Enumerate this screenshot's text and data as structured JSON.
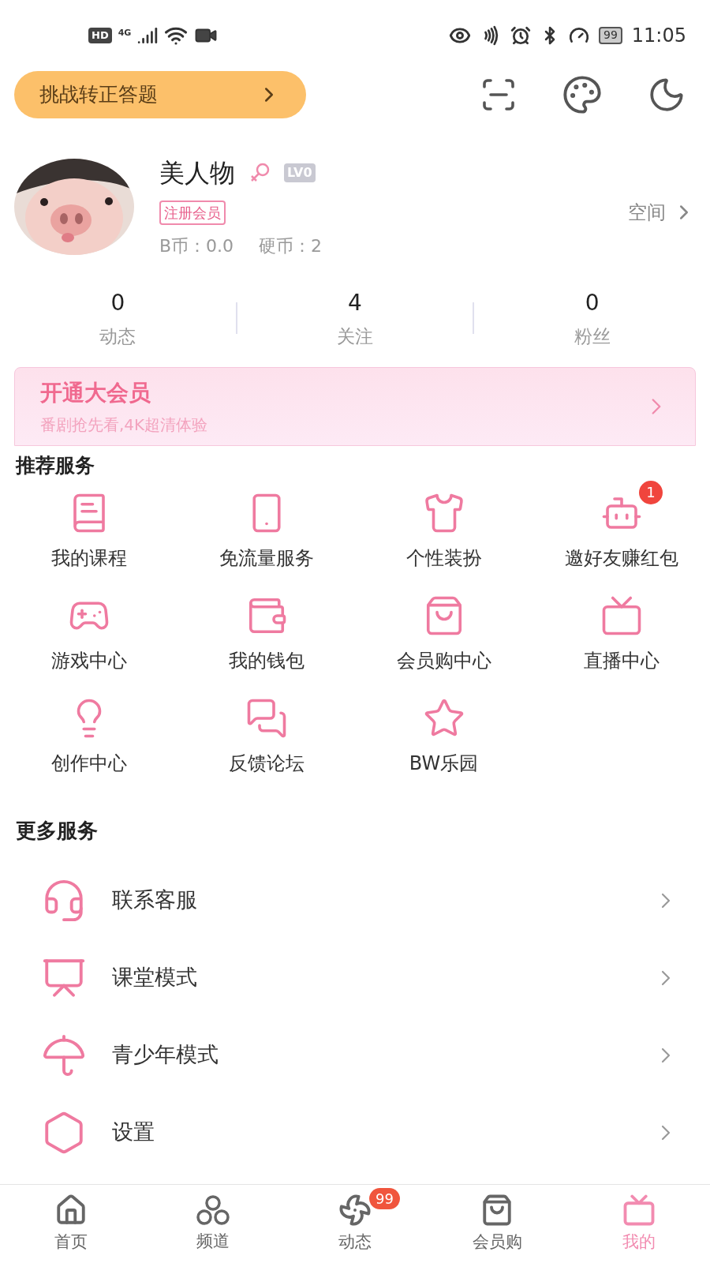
{
  "status_bar": {
    "hd": "HD",
    "network": "4G",
    "battery": "99",
    "time": "11:05"
  },
  "top_bar": {
    "quiz_button": "挑战转正答题"
  },
  "profile": {
    "name": "美人物",
    "level": "LV0",
    "member_tag": "注册会员",
    "b_coins": "B币：0.0",
    "coins": "硬币：2",
    "space_link": "空间"
  },
  "stats": [
    {
      "value": "0",
      "label": "动态"
    },
    {
      "value": "4",
      "label": "关注"
    },
    {
      "value": "0",
      "label": "粉丝"
    }
  ],
  "vip_banner": {
    "title": "开通大会员",
    "subtitle": "番剧抢先看,4K超清体验"
  },
  "recommended": {
    "title": "推荐服务",
    "items": [
      {
        "label": "我的课程"
      },
      {
        "label": "免流量服务"
      },
      {
        "label": "个性装扮"
      },
      {
        "label": "邀好友赚红包",
        "badge": "1"
      },
      {
        "label": "游戏中心"
      },
      {
        "label": "我的钱包"
      },
      {
        "label": "会员购中心"
      },
      {
        "label": "直播中心"
      },
      {
        "label": "创作中心"
      },
      {
        "label": "反馈论坛"
      },
      {
        "label": "BW乐园"
      }
    ]
  },
  "more_services": {
    "title": "更多服务",
    "items": [
      {
        "label": "联系客服"
      },
      {
        "label": "课堂模式"
      },
      {
        "label": "青少年模式"
      },
      {
        "label": "设置"
      }
    ]
  },
  "bottom_nav": [
    {
      "label": "首页",
      "selected": false
    },
    {
      "label": "频道",
      "selected": false
    },
    {
      "label": "动态",
      "selected": false,
      "badge": "99"
    },
    {
      "label": "会员购",
      "selected": false
    },
    {
      "label": "我的",
      "selected": true
    }
  ]
}
